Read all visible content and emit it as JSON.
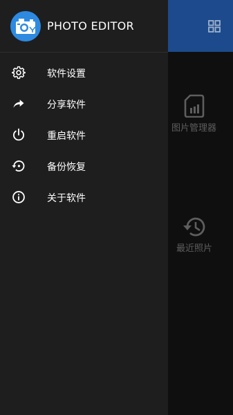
{
  "app": {
    "title": "PHOTO EDITOR",
    "logo_icon": "camera-icon"
  },
  "drawer": {
    "items": [
      {
        "label": "软件设置",
        "icon": "gear-icon"
      },
      {
        "label": "分享软件",
        "icon": "share-arrow-icon"
      },
      {
        "label": "重启软件",
        "icon": "power-icon"
      },
      {
        "label": "备份恢复",
        "icon": "backup-restore-icon"
      },
      {
        "label": "关于软件",
        "icon": "info-icon"
      }
    ]
  },
  "main": {
    "tiles": [
      {
        "label": "图片管理器",
        "icon": "sd-card-icon"
      },
      {
        "label": "最近照片",
        "icon": "history-icon"
      }
    ],
    "toolbar_icon": "grid-view-icon"
  },
  "colors": {
    "app_bar": "#1c4a8c",
    "drawer_bg": "#1e1e1e",
    "main_bg": "#0f0f0f",
    "logo_bg": "#2d8ae0",
    "muted_text": "#5e5e5e"
  }
}
